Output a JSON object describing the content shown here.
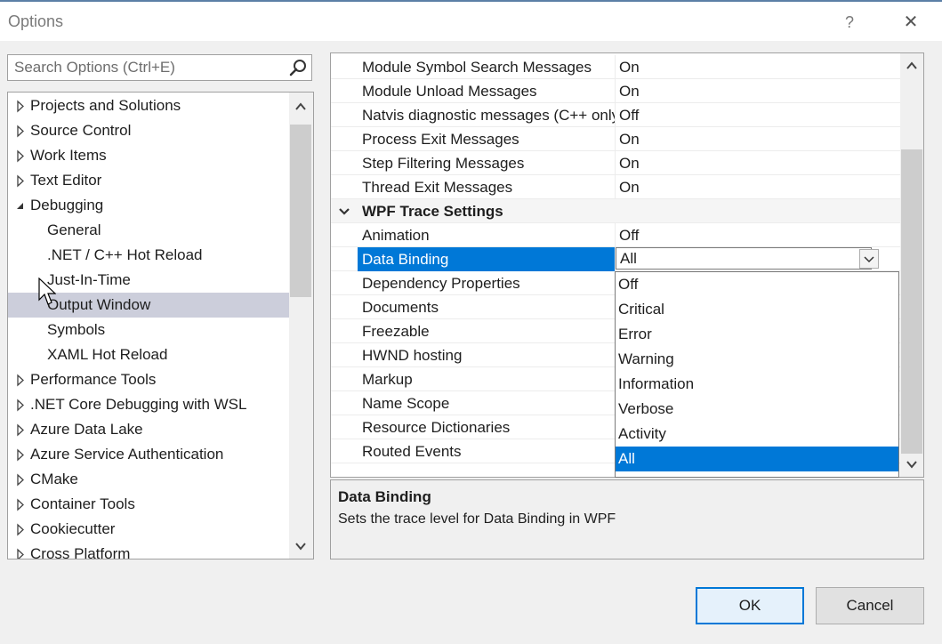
{
  "window": {
    "title": "Options",
    "help_label": "?",
    "close_label": "✕"
  },
  "search": {
    "placeholder": "Search Options (Ctrl+E)",
    "value": ""
  },
  "tree": {
    "items": [
      {
        "label": "Projects and Solutions",
        "level": 0,
        "expander": "collapsed"
      },
      {
        "label": "Source Control",
        "level": 0,
        "expander": "collapsed"
      },
      {
        "label": "Work Items",
        "level": 0,
        "expander": "collapsed"
      },
      {
        "label": "Text Editor",
        "level": 0,
        "expander": "collapsed"
      },
      {
        "label": "Debugging",
        "level": 0,
        "expander": "expanded"
      },
      {
        "label": "General",
        "level": 1
      },
      {
        "label": ".NET / C++ Hot Reload",
        "level": 1
      },
      {
        "label": "Just-In-Time",
        "level": 1
      },
      {
        "label": "Output Window",
        "level": 1,
        "selected": true
      },
      {
        "label": "Symbols",
        "level": 1
      },
      {
        "label": "XAML Hot Reload",
        "level": 1
      },
      {
        "label": "Performance Tools",
        "level": 0,
        "expander": "collapsed"
      },
      {
        "label": ".NET Core Debugging with WSL",
        "level": 0,
        "expander": "collapsed"
      },
      {
        "label": "Azure Data Lake",
        "level": 0,
        "expander": "collapsed"
      },
      {
        "label": "Azure Service Authentication",
        "level": 0,
        "expander": "collapsed"
      },
      {
        "label": "CMake",
        "level": 0,
        "expander": "collapsed"
      },
      {
        "label": "Container Tools",
        "level": 0,
        "expander": "collapsed"
      },
      {
        "label": "Cookiecutter",
        "level": 0,
        "expander": "collapsed"
      },
      {
        "label": "Cross Platform",
        "level": 0,
        "expander": "collapsed"
      }
    ]
  },
  "properties": {
    "rows": [
      {
        "name": "Module Symbol Search Messages",
        "value": "On"
      },
      {
        "name": "Module Unload Messages",
        "value": "On"
      },
      {
        "name": "Natvis diagnostic messages (C++ only)",
        "value": "Off"
      },
      {
        "name": "Process Exit Messages",
        "value": "On"
      },
      {
        "name": "Step Filtering Messages",
        "value": "On"
      },
      {
        "name": "Thread Exit Messages",
        "value": "On"
      },
      {
        "name": "WPF Trace Settings",
        "value": "",
        "section": true
      },
      {
        "name": "Animation",
        "value": "Off"
      },
      {
        "name": "Data Binding",
        "value": "All",
        "selected": true
      },
      {
        "name": "Dependency Properties",
        "value": ""
      },
      {
        "name": "Documents",
        "value": ""
      },
      {
        "name": "Freezable",
        "value": ""
      },
      {
        "name": "HWND hosting",
        "value": ""
      },
      {
        "name": "Markup",
        "value": ""
      },
      {
        "name": "Name Scope",
        "value": ""
      },
      {
        "name": "Resource Dictionaries",
        "value": ""
      },
      {
        "name": "Routed Events",
        "value": ""
      }
    ]
  },
  "dropdown": {
    "options": [
      "Off",
      "Critical",
      "Error",
      "Warning",
      "Information",
      "Verbose",
      "Activity",
      "All"
    ],
    "selected": "All"
  },
  "description": {
    "title": "Data Binding",
    "text": "Sets the trace level for Data Binding in WPF"
  },
  "buttons": {
    "ok": "OK",
    "cancel": "Cancel"
  },
  "colors": {
    "accent": "#0078d7",
    "tree_selection": "#cccedb"
  }
}
